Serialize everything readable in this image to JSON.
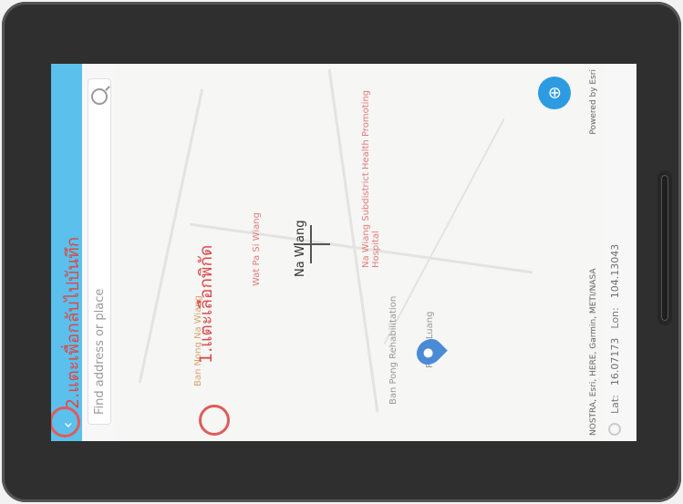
{
  "annotations": {
    "step1": "1.แตะเลือกพิกัด",
    "step2": "2.แตะเพื่อกลับไปบันทึก"
  },
  "search": {
    "placeholder": "Find address or place"
  },
  "map": {
    "center_label": "Na Wiang",
    "place_names": [
      "Ban Nong Na Wiang",
      "Wat Pa Si Wiang",
      "Na Wiang Subdistrict Health Promoting Hospital",
      "Ban Pong Rehabilitation",
      "Phrao Luang"
    ]
  },
  "attribution": {
    "sources": "NOSTRA, Esri, HERE, Garmin, METI/NASA",
    "powered": "Powered by Esri"
  },
  "coordinates": {
    "lat_label": "Lat:",
    "lat_value": "16.07173",
    "lon_label": "Lon:",
    "lon_value": "104.13043"
  },
  "colors": {
    "top_bar": "#5bc0eb",
    "accent": "#2d9be2",
    "annotation": "#d94b4b"
  },
  "icons": {
    "back": "chevron-left-icon",
    "search": "search-icon",
    "zoom_in": "plus-icon",
    "zoom_out": "minus-icon",
    "home": "home-icon",
    "layers": "layers-icon",
    "list": "list-icon",
    "add_location": "add-location-icon",
    "location": "location-pin-icon"
  }
}
